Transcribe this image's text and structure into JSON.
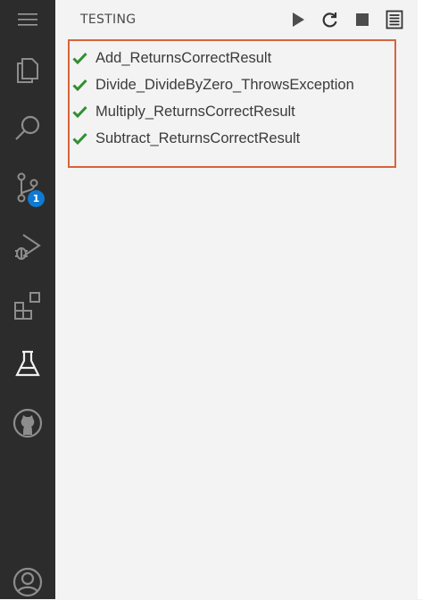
{
  "activity_bar": {
    "items": [
      {
        "name": "menu-icon"
      },
      {
        "name": "explorer-icon"
      },
      {
        "name": "search-icon"
      },
      {
        "name": "source-control-icon",
        "badge": "1"
      },
      {
        "name": "run-debug-icon"
      },
      {
        "name": "extensions-icon"
      },
      {
        "name": "testing-icon",
        "active": true
      },
      {
        "name": "github-icon"
      },
      {
        "name": "accounts-icon"
      }
    ],
    "background": "#2c2c2c",
    "badge_color": "#0e7ad1"
  },
  "panel": {
    "title": "TESTING",
    "toolbar": [
      "run-all-icon",
      "refresh-icon",
      "stop-icon",
      "output-icon"
    ]
  },
  "tests": [
    {
      "label": "Add_ReturnsCorrectResult",
      "status": "passed"
    },
    {
      "label": "Divide_DivideByZero_ThrowsException",
      "status": "passed"
    },
    {
      "label": "Multiply_ReturnsCorrectResult",
      "status": "passed"
    },
    {
      "label": "Subtract_ReturnsCorrectResult",
      "status": "passed"
    }
  ],
  "colors": {
    "highlight_border": "#d7643b",
    "passed_check": "#2f8f2f"
  }
}
